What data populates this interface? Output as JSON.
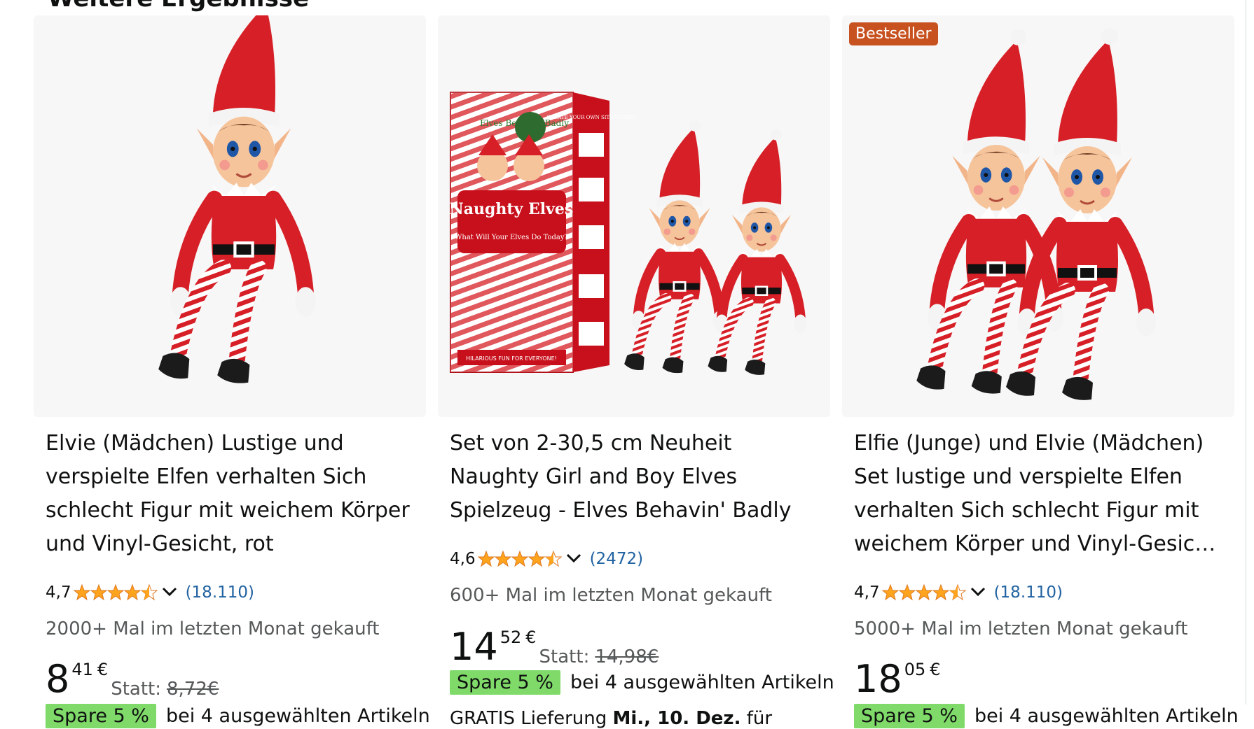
{
  "section": {
    "title": "Weitere Ergebnisse"
  },
  "colors": {
    "star": "#ffa41c",
    "badge": "#c7511f",
    "spare": "#7fda69",
    "link": "#2162a1"
  },
  "products": [
    {
      "badge": "",
      "title": "Elvie (Mädchen) Lustige und verspielte Elfen verhalten Sich schlecht Figur mit weichem Körper und Vinyl-Gesicht, rot",
      "rating": "4,7",
      "stars": 4.5,
      "review_count": "(18.110)",
      "bought": "2000+ Mal im letzten Monat gekauft",
      "price_whole": "8",
      "price_fraction": "41",
      "currency": "€",
      "statt_label": "Statt:",
      "statt_price": "8,72€",
      "spare": "Spare 5 %",
      "promo": "bei 4 ausgewählten Artikeln",
      "delivery_prefix": "",
      "delivery_date": "",
      "delivery_suffix": ""
    },
    {
      "badge": "",
      "title": "Set von 2-30,5 cm Neuheit Naughty Girl and Boy Elves Spielzeug - Elves Behavin' Badly",
      "rating": "4,6",
      "stars": 4.5,
      "review_count": "(2472)",
      "bought": "600+ Mal im letzten Monat gekauft",
      "price_whole": "14",
      "price_fraction": "52",
      "currency": "€",
      "statt_label": "Statt:",
      "statt_price": "14,98€",
      "spare": "Spare 5 %",
      "promo": "bei 4 ausgewählten Artikeln",
      "delivery_prefix": "GRATIS Lieferung",
      "delivery_date": "Mi., 10. Dez.",
      "delivery_suffix": "für"
    },
    {
      "badge": "Bestseller",
      "title": "Elfie (Junge) und Elvie (Mädchen) Set lustige und verspielte Elfen verhalten Sich schlecht Figur mit weichem Körper und Vinyl-Gesicht, rot",
      "rating": "4,7",
      "stars": 4.5,
      "review_count": "(18.110)",
      "bought": "5000+ Mal im letzten Monat gekauft",
      "price_whole": "18",
      "price_fraction": "05",
      "currency": "€",
      "statt_label": "",
      "statt_price": "",
      "spare": "Spare 5 %",
      "promo": "bei 4 ausgewählten Artikeln",
      "delivery_prefix": "",
      "delivery_date": "",
      "delivery_suffix": ""
    }
  ],
  "box_text": {
    "brand": "Elves Behavin' Badly",
    "name": "Naughty Elves",
    "tagline": "What Will Your Elves Do Today?",
    "side": "CREATE YOUR OWN SITUATIONS!",
    "footer": "HILARIOUS FUN FOR EVERYONE!"
  }
}
